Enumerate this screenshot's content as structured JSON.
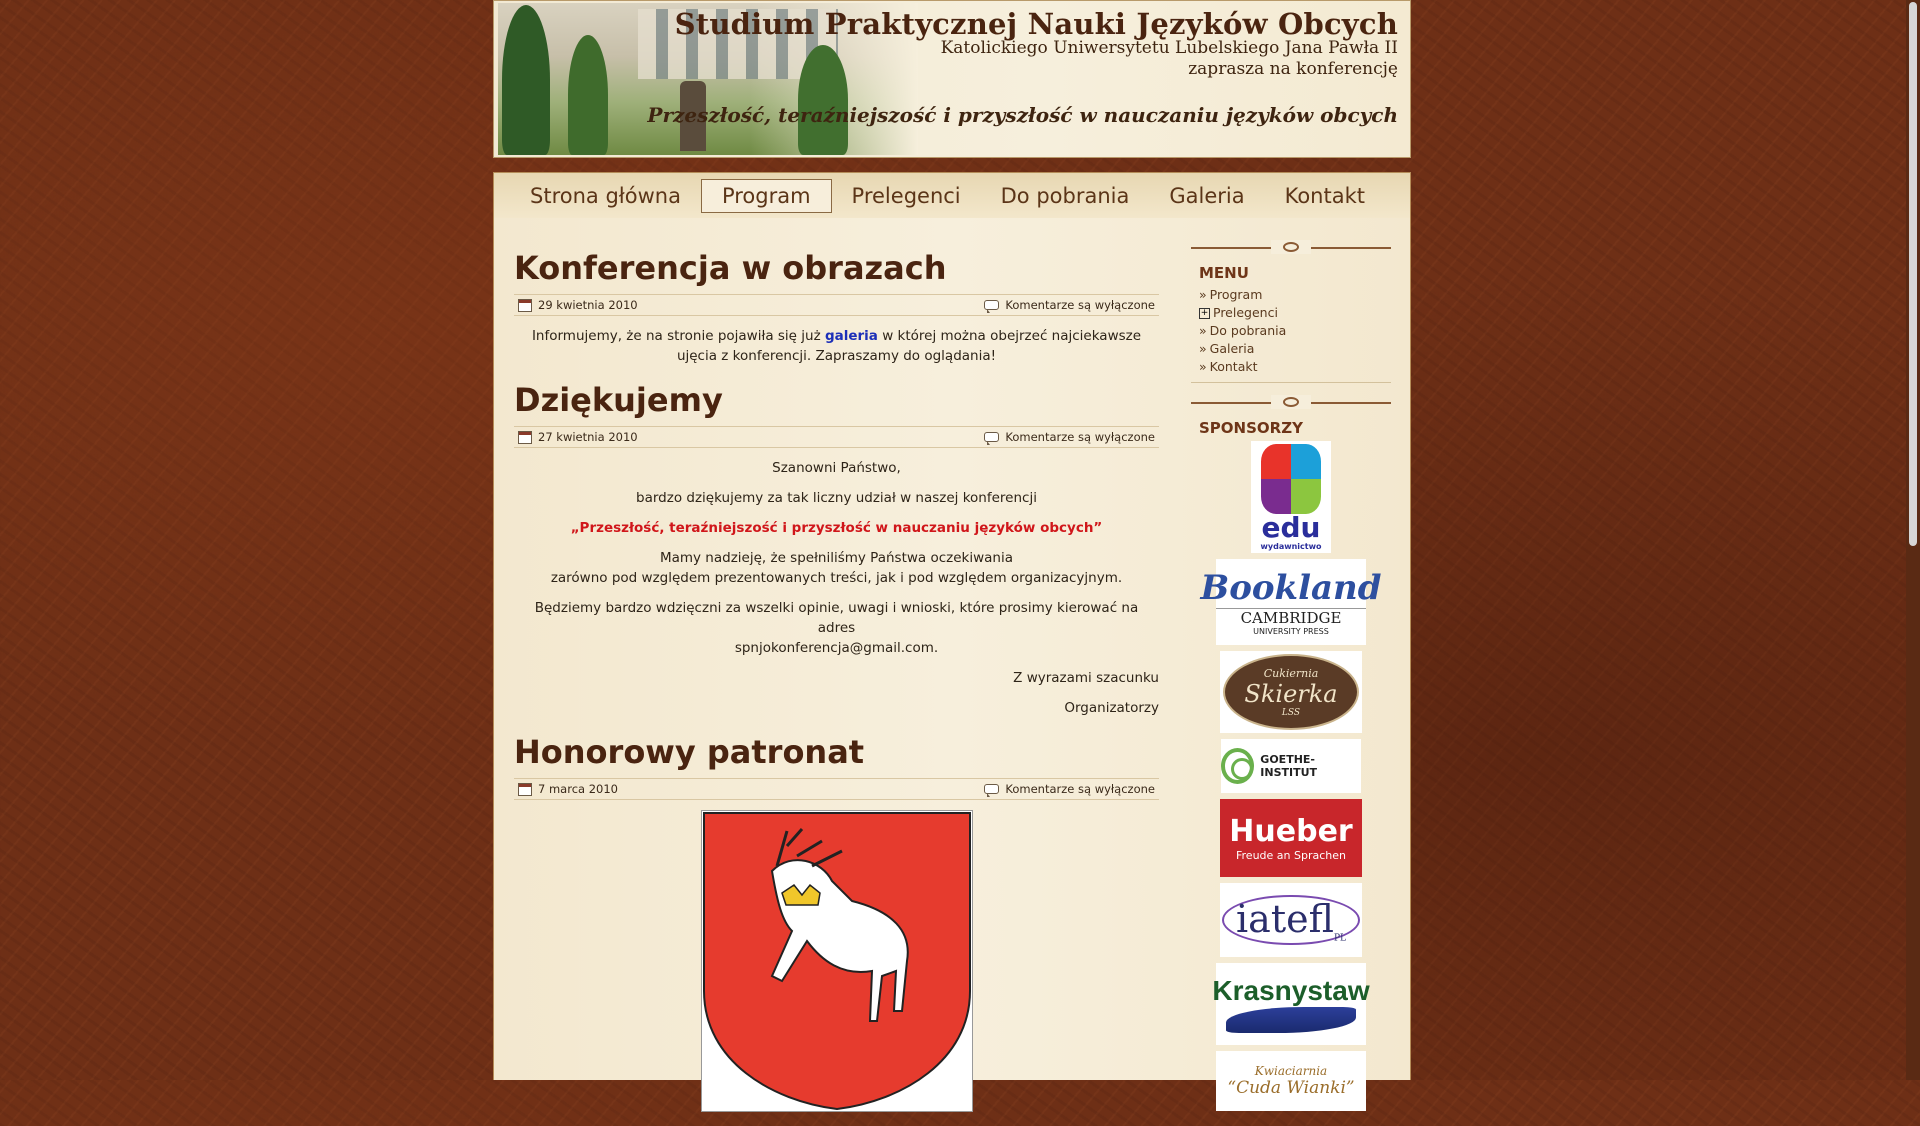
{
  "header": {
    "title": "Studium Praktycznej Nauki Języków Obcych",
    "subtitle1": "Katolickiego Uniwersytetu Lubelskiego Jana Pawła II",
    "subtitle2": "zaprasza na konferencję",
    "slogan": "Przeszłość, teraźniejszość i przyszłość w nauczaniu języków obcych"
  },
  "nav": {
    "items": [
      "Strona główna",
      "Program",
      "Prelegenci",
      "Do pobrania",
      "Galeria",
      "Kontakt"
    ],
    "active": "Program"
  },
  "posts": [
    {
      "title": "Konferencja w obrazach",
      "date": "29 kwietnia 2010",
      "comments": "Komentarze są wyłączone",
      "text_before": "Informujemy, że na stronie pojawiła się już",
      "link": "galeria",
      "text_after": "w której można obejrzeć najciekawsze ujęcia z konferencji. Zapraszamy do oglądania!"
    },
    {
      "title": "Dziękujemy",
      "date": "27 kwietnia 2010",
      "comments": "Komentarze są wyłączone",
      "p1": "Szanowni Państwo,",
      "p2": "bardzo dziękujemy za tak liczny udział w naszej konferencji",
      "p3": "„Przeszłość, teraźniejszość i przyszłość w nauczaniu języków obcych”",
      "p4a": "Mamy nadzieję, że spełniliśmy Państwa oczekiwania",
      "p4b": "zarówno pod względem prezentowanych treści, jak i pod względem organizacyjnym.",
      "p5a": "Będziemy bardzo wdzięczni za wszelki opinie, uwagi i wnioski, które prosimy kierować na adres",
      "p5b": "spnjokonferencja@gmail.com.",
      "p6": "Z wyrazami szacunku",
      "p7": "Organizatorzy"
    },
    {
      "title": "Honorowy patronat",
      "date": "7 marca 2010",
      "comments": "Komentarze są wyłączone"
    }
  ],
  "sidebar": {
    "menu_title": "MENU",
    "menu_items": [
      {
        "prefix": "»",
        "label": "Program"
      },
      {
        "prefix": "+",
        "label": "Prelegenci"
      },
      {
        "prefix": "»",
        "label": "Do pobrania"
      },
      {
        "prefix": "»",
        "label": "Galeria"
      },
      {
        "prefix": "»",
        "label": "Kontakt"
      }
    ],
    "sponsors_title": "SPONSORZY",
    "sponsors": {
      "edu": {
        "name": "edu",
        "sub": "wydawnictwo"
      },
      "bookland": {
        "name": "Bookland",
        "cambridge": "CAMBRIDGE",
        "press": "UNIVERSITY PRESS"
      },
      "skierka": {
        "top": "Cukiernia",
        "name": "Skierka",
        "sub": "LSS"
      },
      "goethe": {
        "name": "GOETHE-INSTITUT"
      },
      "hueber": {
        "name": "Hueber",
        "sub": "Freude an Sprachen"
      },
      "iatefl": {
        "name": "iatefl",
        "sub": "PL"
      },
      "krasnystaw": {
        "name": "Krasnystaw"
      },
      "kwiaciarnia": {
        "top": "Kwiaciarnia",
        "name": "“Cuda Wianki”"
      }
    }
  },
  "colors": {
    "accent_red": "#d0161a",
    "link_blue": "#1c2fb8",
    "brown": "#4a2410"
  }
}
